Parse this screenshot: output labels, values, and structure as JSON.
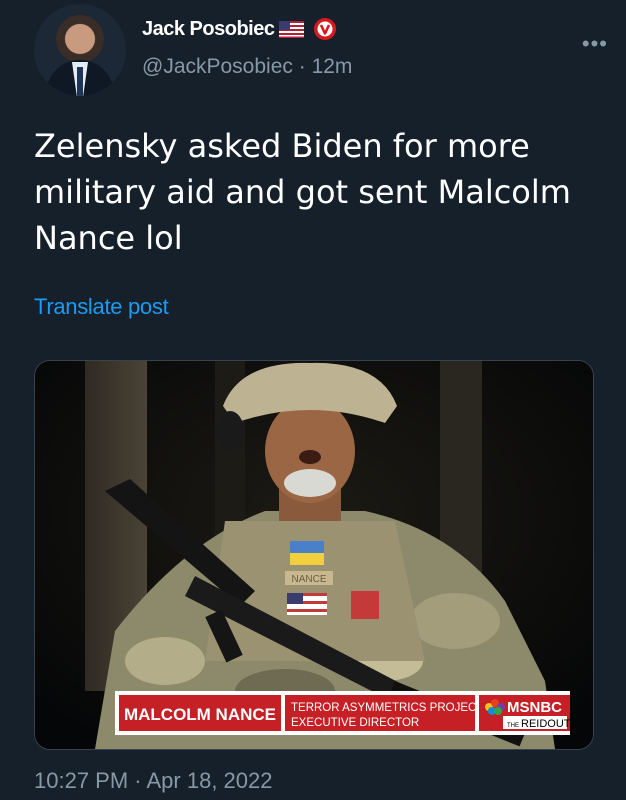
{
  "author": {
    "display_name": "Jack Posobiec",
    "handle": "@JackPosobiec",
    "separator": "·",
    "time_ago": "12m"
  },
  "tweet": {
    "text": "Zelensky asked Biden for more military aid and got sent Malcolm Nance lol",
    "translate_label": "Translate post",
    "timestamp": "10:27 PM · Apr 18, 2022"
  },
  "media": {
    "name_label": "MALCOLM NANCE",
    "title_line1": "TERROR ASYMMETRICS PROJECT",
    "title_line2": "EXECUTIVE DIRECTOR",
    "network": "MSNBC",
    "show_prefix": "THE",
    "show": "REIDOUT",
    "name_tape": "NANCE"
  },
  "icons": {
    "flag": "us-flag-icon",
    "verified": "verified-badge-icon",
    "more": "more-icon"
  },
  "colors": {
    "background": "#15202b",
    "secondary_text": "#8899a6",
    "link": "#1d9bf0",
    "lower_third_red": "#c42026"
  }
}
